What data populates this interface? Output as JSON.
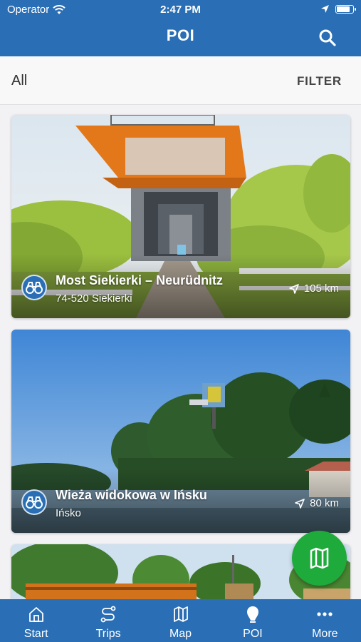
{
  "status_bar": {
    "carrier": "Operator",
    "time": "2:47 PM"
  },
  "header": {
    "title": "POI"
  },
  "filter_bar": {
    "selected": "All",
    "filter_label": "FILTER"
  },
  "pois": [
    {
      "name": "Most Siekierki – Neurüdnitz",
      "address": "74-520 Siekierki",
      "distance": "105 km",
      "category_icon": "binoculars-icon"
    },
    {
      "name": "Wieża widokowa w Ińsku",
      "address": "Ińsko",
      "distance": "80 km",
      "category_icon": "binoculars-icon"
    }
  ],
  "tabs": [
    {
      "label": "Start",
      "icon": "home-icon"
    },
    {
      "label": "Trips",
      "icon": "route-icon"
    },
    {
      "label": "Map",
      "icon": "map-icon"
    },
    {
      "label": "POI",
      "icon": "poi-icon"
    },
    {
      "label": "More",
      "icon": "more-icon"
    }
  ],
  "colors": {
    "primary": "#2a6fb5",
    "fab": "#1faa3c"
  }
}
